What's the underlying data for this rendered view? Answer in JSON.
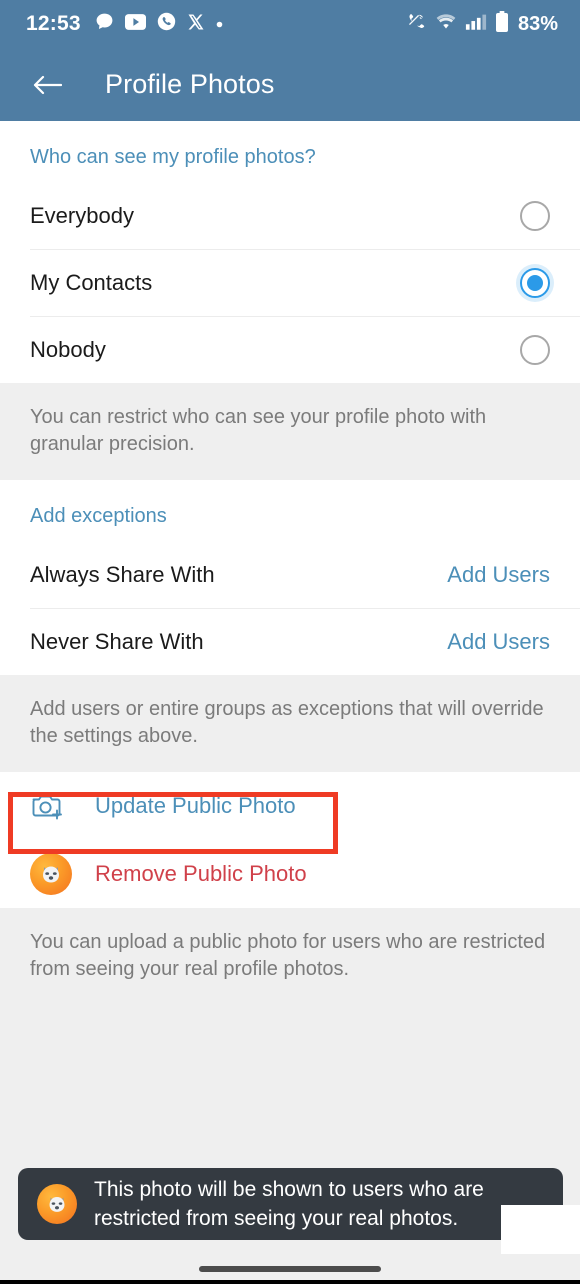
{
  "status_bar": {
    "time": "12:53",
    "battery_percent": "83%",
    "left_icons": [
      "chat-bubble-icon",
      "youtube-icon",
      "phone-circle-icon",
      "x-twitter-icon",
      "dot-icon"
    ],
    "right_icons": [
      "phone-mute-icon",
      "wifi-icon",
      "signal-bars-icon",
      "battery-icon"
    ]
  },
  "app_bar": {
    "back_icon": "back-arrow-icon",
    "title": "Profile Photos"
  },
  "visibility_section": {
    "header": "Who can see my profile photos?",
    "options": [
      {
        "label": "Everybody",
        "selected": false
      },
      {
        "label": "My Contacts",
        "selected": true
      },
      {
        "label": "Nobody",
        "selected": false
      }
    ],
    "info": "You can restrict who can see your profile photo with granular precision."
  },
  "exceptions_section": {
    "header": "Add exceptions",
    "rows": [
      {
        "label": "Always Share With",
        "action": "Add Users"
      },
      {
        "label": "Never Share With",
        "action": "Add Users"
      }
    ],
    "info": "Add users or entire groups as exceptions that will override the settings above."
  },
  "public_photo_section": {
    "update_label": "Update Public Photo",
    "update_icon": "camera-plus-icon",
    "remove_label": "Remove Public Photo",
    "remove_icon": "profile-avatar-icon",
    "info": "You can upload a public photo for users who are restricted from seeing your real profile photos."
  },
  "toast": {
    "avatar_icon": "profile-avatar-icon",
    "message": "This photo will be shown to users who are restricted from seeing your real photos."
  },
  "annotation": {
    "highlight_target": "remove-public-photo-row",
    "color": "#ef3b24"
  },
  "colors": {
    "header_blue": "#4f7da3",
    "accent_blue": "#4c8fb8",
    "radio_blue": "#2b9ae8",
    "danger_red": "#d0414a",
    "page_bg": "#efefef",
    "toast_bg": "#343a41"
  },
  "nav": {
    "gesture_pill": "home-gesture-pill"
  }
}
